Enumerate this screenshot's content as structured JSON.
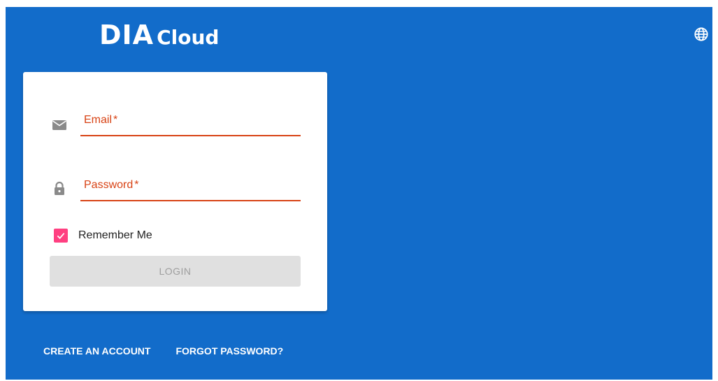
{
  "brand": {
    "logo_main": "DIA",
    "logo_sub": "Cloud"
  },
  "header": {
    "language_icon": "globe-icon"
  },
  "login_form": {
    "email": {
      "label": "Email",
      "required_marker": "*",
      "value": "",
      "icon": "envelope-icon"
    },
    "password": {
      "label": "Password",
      "required_marker": "*",
      "value": "",
      "icon": "lock-icon"
    },
    "remember_me": {
      "label": "Remember Me",
      "checked": true
    },
    "login_button": {
      "label": "LOGIN",
      "disabled": true
    }
  },
  "footer_links": {
    "create_account": "CREATE AN ACCOUNT",
    "forgot_password": "FORGOT PASSWORD?"
  },
  "colors": {
    "background": "#126cca",
    "card": "#ffffff",
    "error": "#d84315",
    "checkbox": "#ff4081",
    "button_disabled": "#e0e0e0",
    "button_text_disabled": "#9e9e9e"
  }
}
